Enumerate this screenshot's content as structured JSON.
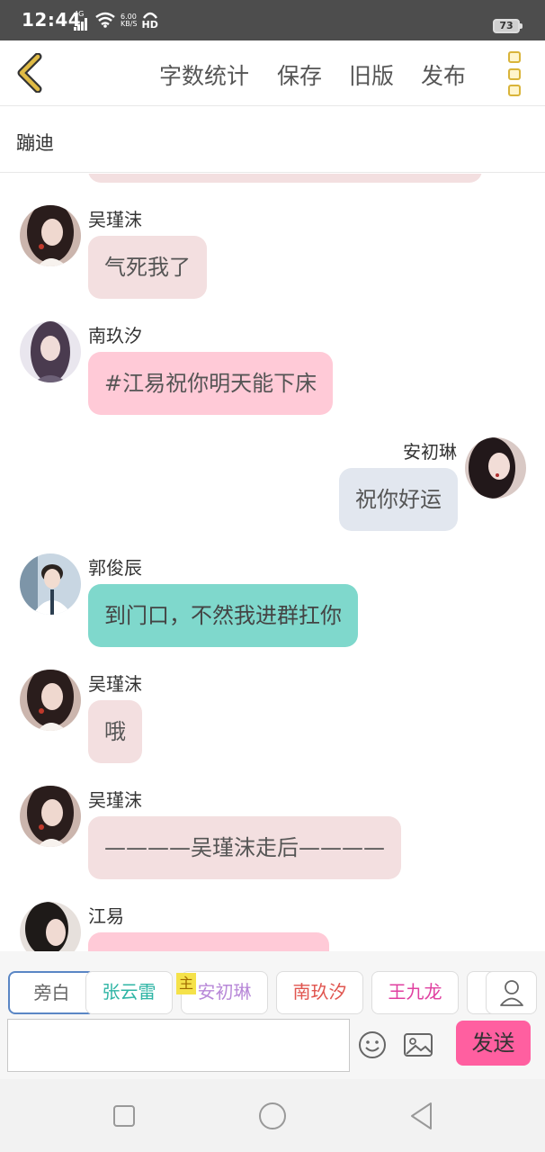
{
  "status_bar": {
    "time": "12:44",
    "network": "4G",
    "speed_value": "6.00",
    "speed_unit": "KB/S",
    "hd": "HD",
    "battery": "73"
  },
  "header": {
    "word_count": "字数统计",
    "save": "保存",
    "old_version": "旧版",
    "publish": "发布"
  },
  "title": "蹦迪",
  "messages": [
    {
      "name": "吴瑾沫",
      "text": "气死我了",
      "side": "left",
      "bubble_color": "#f3dfe0",
      "text_color": "#555555"
    },
    {
      "name": "南玖汐",
      "text": "#江易祝你明天能下床",
      "side": "left",
      "bubble_color": "#ffcad7",
      "text_color": "#555555"
    },
    {
      "name": "安初琳",
      "text": "祝你好运",
      "side": "right",
      "bubble_color": "#e2e7ef",
      "text_color": "#555555"
    },
    {
      "name": "郭俊辰",
      "text": "到门口，不然我进群扛你",
      "side": "left",
      "bubble_color": "#7fd8cc",
      "text_color": "#444444"
    },
    {
      "name": "吴瑾沫",
      "text": "哦",
      "side": "left",
      "bubble_color": "#f3dfe0",
      "text_color": "#555555"
    },
    {
      "name": "吴瑾沫",
      "text": "————吴瑾沫走后————",
      "side": "left",
      "bubble_color": "#f3dfe0",
      "text_color": "#555555"
    },
    {
      "name": "江易",
      "text": "",
      "side": "left",
      "bubble_color": "#ffcad7",
      "text_color": "#555555"
    }
  ],
  "characters": [
    {
      "label": "旁白",
      "color": "#666666",
      "active": true
    },
    {
      "label": "张云雷",
      "color": "#2fb5a5",
      "active": false
    },
    {
      "label": "安初琳",
      "color": "#b888d8",
      "active": false,
      "host_badge": "主"
    },
    {
      "label": "南玖汐",
      "color": "#e0554f",
      "active": false
    },
    {
      "label": "王九龙",
      "color": "#e040a0",
      "active": false
    }
  ],
  "composer": {
    "placeholder": "",
    "send_label": "发送"
  },
  "colors": {
    "accent_yellow": "#d9b43a",
    "send_pink": "#ff5fa0",
    "active_tab_border": "#5a86c5"
  }
}
